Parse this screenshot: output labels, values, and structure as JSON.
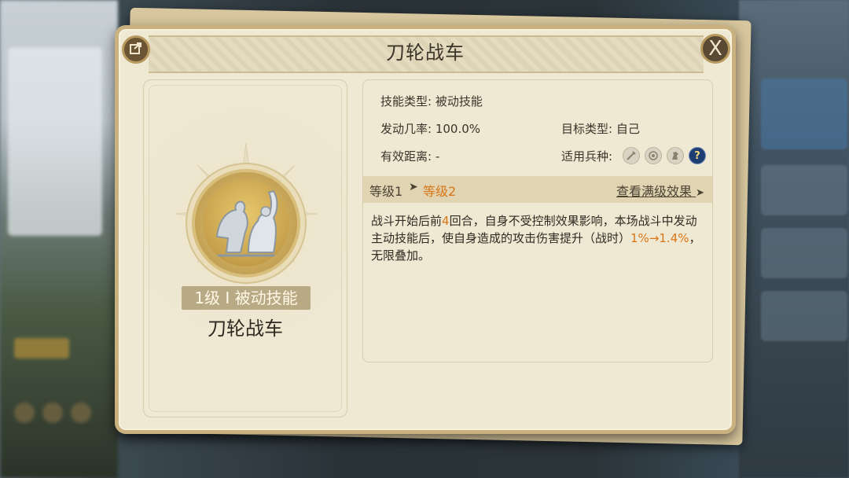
{
  "dialog": {
    "title": "刀轮战车",
    "share_icon": "share-icon",
    "close_icon": "close-icon",
    "close_label": "X"
  },
  "skill": {
    "badge": "1级 I 被动技能",
    "name": "刀轮战车"
  },
  "info": {
    "skill_type_label": "技能类型:",
    "skill_type_value": "被动技能",
    "trigger_rate_label": "发动几率:",
    "trigger_rate_value": "100.0%",
    "target_type_label": "目标类型:",
    "target_type_value": "自己",
    "range_label": "有效距离:",
    "range_value": "-",
    "troops_label": "适用兵种:",
    "troop_icons": [
      "sword-troop-icon",
      "archer-troop-icon",
      "cavalry-troop-icon",
      "unknown-troop-icon"
    ]
  },
  "levels": {
    "current": "等级1",
    "arrow": "➤",
    "next": "等级2",
    "view_max": "查看满级效果",
    "view_max_arrow": "➤"
  },
  "description": {
    "part1": "战斗开始后前",
    "highlight1": "4",
    "part2": "回合，自身不受控制效果影响，本场战斗中发动主动技能后，使自身造成的攻击伤害提升（战时）",
    "highlight2": "1%→1.4%",
    "part3": "，无限叠加。"
  },
  "colors": {
    "panel": "#efe8d3",
    "border": "#c9b27f",
    "highlight": "#d97617",
    "level_bar": "#e0d4b3"
  }
}
